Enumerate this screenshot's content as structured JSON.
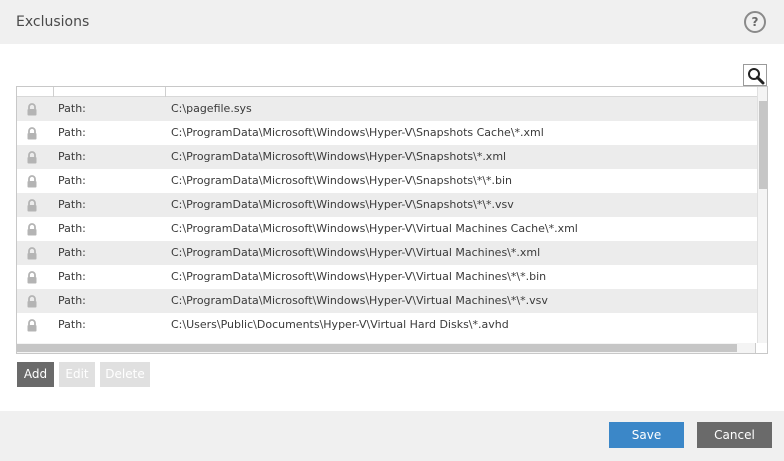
{
  "window": {
    "title": "Exclusions",
    "help_label": "?"
  },
  "table": {
    "rows": [
      {
        "type": "Path:",
        "path": "C:\\pagefile.sys"
      },
      {
        "type": "Path:",
        "path": "C:\\ProgramData\\Microsoft\\Windows\\Hyper-V\\Snapshots Cache\\*.xml"
      },
      {
        "type": "Path:",
        "path": "C:\\ProgramData\\Microsoft\\Windows\\Hyper-V\\Snapshots\\*.xml"
      },
      {
        "type": "Path:",
        "path": "C:\\ProgramData\\Microsoft\\Windows\\Hyper-V\\Snapshots\\*\\*.bin"
      },
      {
        "type": "Path:",
        "path": "C:\\ProgramData\\Microsoft\\Windows\\Hyper-V\\Snapshots\\*\\*.vsv"
      },
      {
        "type": "Path:",
        "path": "C:\\ProgramData\\Microsoft\\Windows\\Hyper-V\\Virtual Machines Cache\\*.xml"
      },
      {
        "type": "Path:",
        "path": "C:\\ProgramData\\Microsoft\\Windows\\Hyper-V\\Virtual Machines\\*.xml"
      },
      {
        "type": "Path:",
        "path": "C:\\ProgramData\\Microsoft\\Windows\\Hyper-V\\Virtual Machines\\*\\*.bin"
      },
      {
        "type": "Path:",
        "path": "C:\\ProgramData\\Microsoft\\Windows\\Hyper-V\\Virtual Machines\\*\\*.vsv"
      },
      {
        "type": "Path:",
        "path": "C:\\Users\\Public\\Documents\\Hyper-V\\Virtual Hard Disks\\*.avhd"
      }
    ]
  },
  "actions": {
    "add": "Add",
    "edit": "Edit",
    "delete": "Delete"
  },
  "footer": {
    "save": "Save",
    "cancel": "Cancel"
  },
  "colors": {
    "primary": "#3b87c8",
    "dark_button": "#6a6a6a",
    "disabled_button": "#e0e0e0",
    "row_alt": "#ececec"
  },
  "icons": {
    "row": "lock-icon",
    "search": "search-icon",
    "help": "help-icon"
  }
}
